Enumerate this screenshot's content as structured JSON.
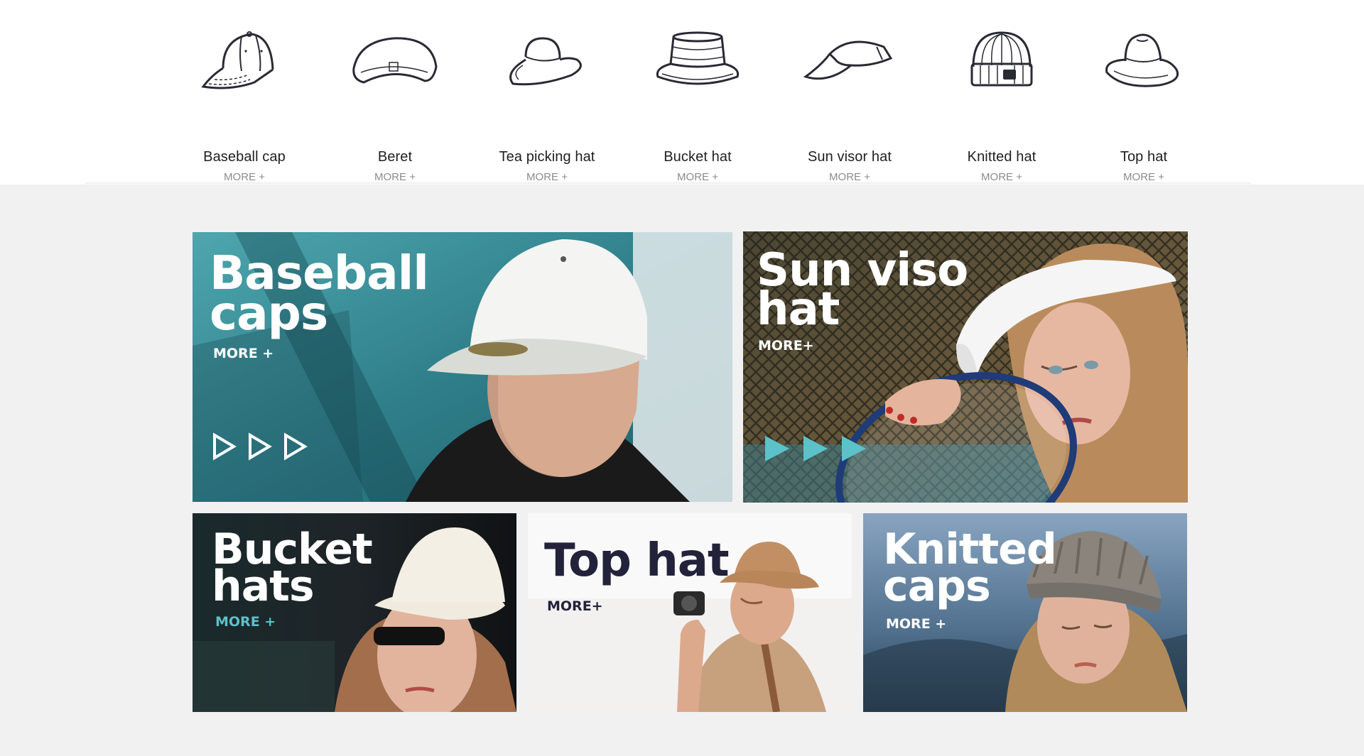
{
  "categories": [
    {
      "name": "Baseball cap",
      "more": "MORE +",
      "icon": "baseball-cap-icon"
    },
    {
      "name": "Beret",
      "more": "MORE +",
      "icon": "beret-icon"
    },
    {
      "name": "Tea picking hat",
      "more": "MORE +",
      "icon": "tea-picking-hat-icon"
    },
    {
      "name": "Bucket hat",
      "more": "MORE +",
      "icon": "bucket-hat-icon"
    },
    {
      "name": "Sun visor hat",
      "more": "MORE +",
      "icon": "sun-visor-icon"
    },
    {
      "name": "Knitted hat",
      "more": "MORE +",
      "icon": "knitted-hat-icon"
    },
    {
      "name": "Top hat",
      "more": "MORE +",
      "icon": "top-hat-icon"
    }
  ],
  "banners": {
    "baseball": {
      "title": "Baseball\ncaps",
      "more": "MORE +",
      "bg": "#3f8f98"
    },
    "sunvisor": {
      "title": "Sun viso\nhat",
      "more": "MORE+",
      "bg": "#5b4f3a"
    },
    "bucket": {
      "title": "Bucket\nhats",
      "more": "MORE +",
      "bg": "#1e2428"
    },
    "tophat": {
      "title": "Top hat",
      "more": "MORE+",
      "bg": "#f0efee"
    },
    "knitted": {
      "title": "Knitted\ncaps",
      "more": "MORE +",
      "bg": "#6b8ba8"
    }
  },
  "colors": {
    "accent_teal": "#5bc2c9",
    "title_dark": "#22223a",
    "line_icon": "#2a2a35"
  }
}
